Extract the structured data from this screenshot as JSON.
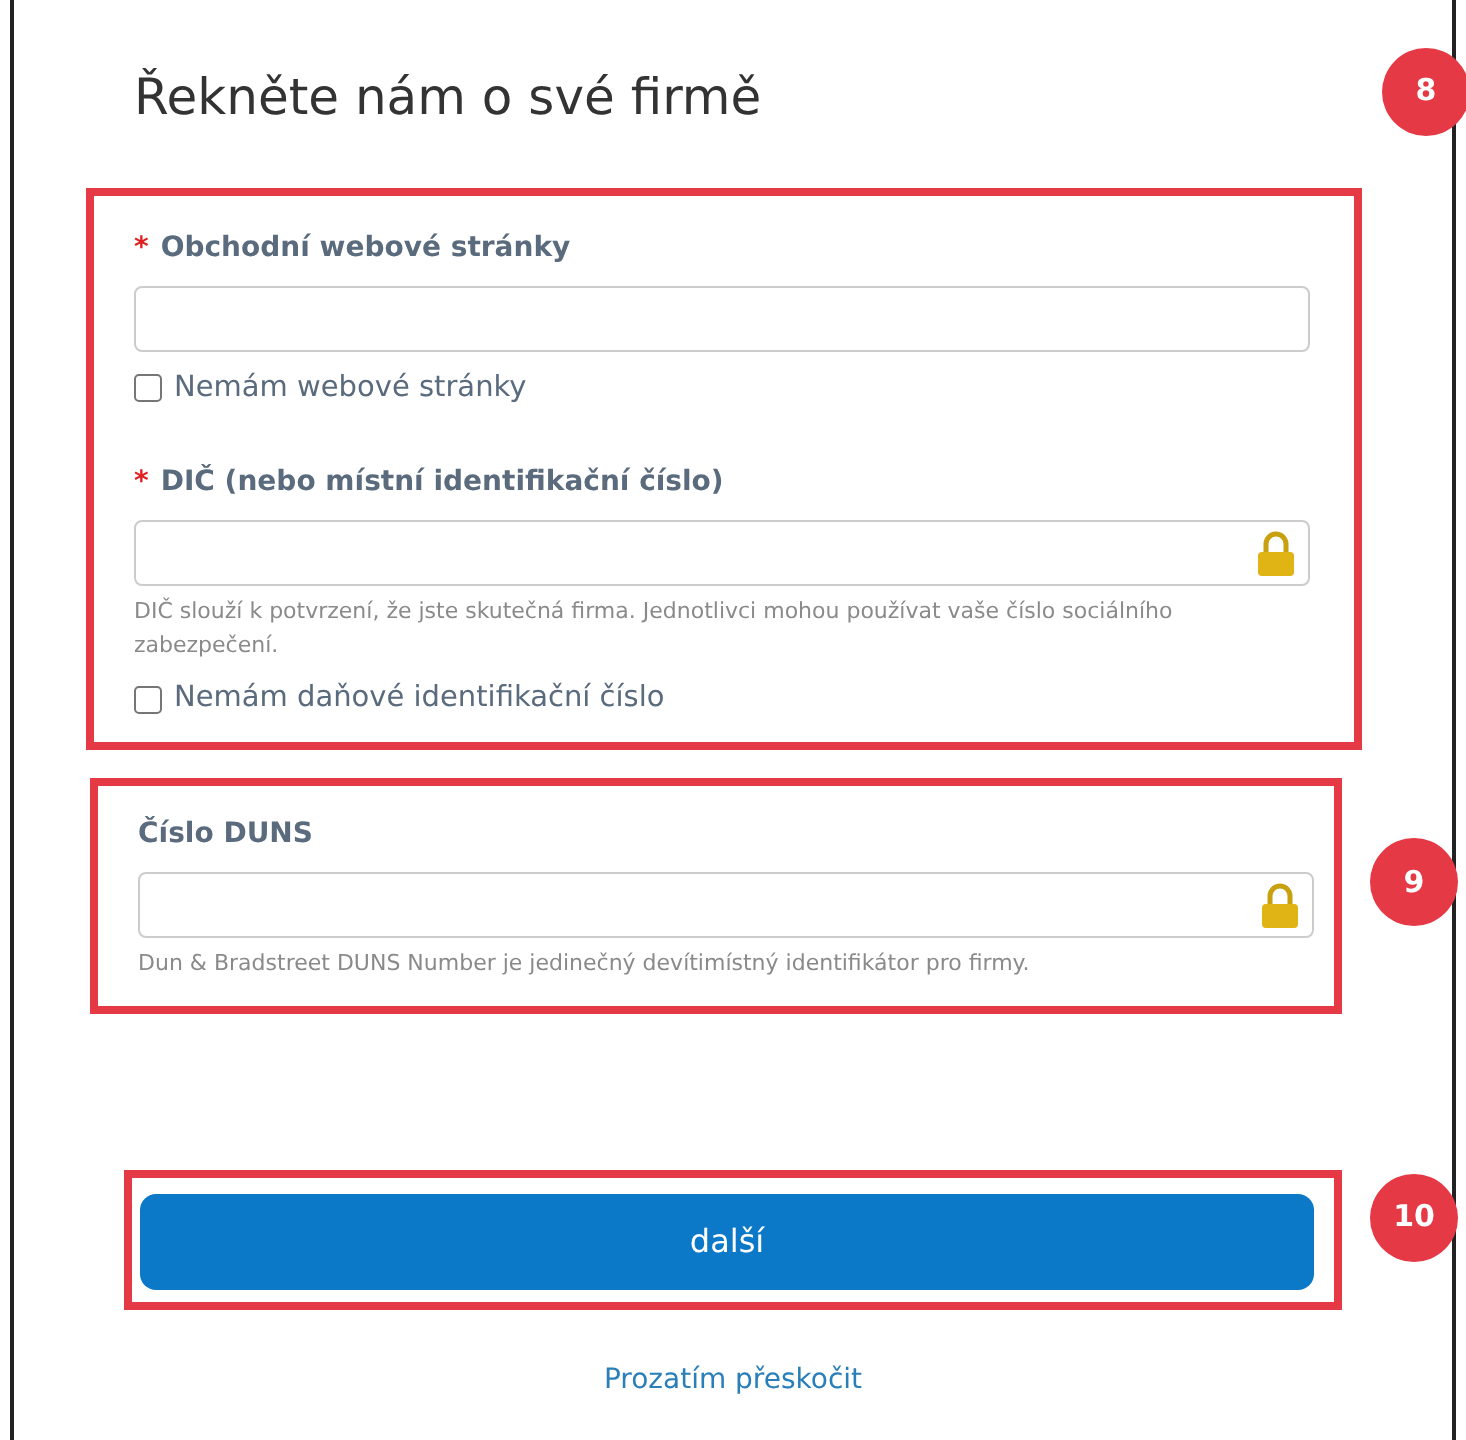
{
  "title": "Řekněte nám o své firmě",
  "sections": [
    {
      "callout": "8",
      "fields": [
        {
          "label": "Obchodní webové stránky",
          "required_marker": "*",
          "kind": "text",
          "checkbox": {
            "label": "Nemám webové stránky",
            "checked": false
          }
        },
        {
          "label": "DIČ (nebo místní identifikační číslo)",
          "required_marker": "*",
          "kind": "locked",
          "help": "DIČ slouží k potvrzení, že jste skutečná firma. Jednotlivci mohou používat vaše číslo sociálního zabezpečení.",
          "checkbox": {
            "label": "Nemám daňové identifikační číslo",
            "checked": false
          }
        }
      ]
    },
    {
      "callout": "9",
      "fields": [
        {
          "label": "Číslo DUNS",
          "kind": "locked",
          "help": "Dun & Bradstreet DUNS Number je jedinečný devítimístný identifikátor pro firmy."
        }
      ]
    }
  ],
  "next_button": {
    "label": "další",
    "callout": "10"
  },
  "skip_link": "Prozatím přeskočit"
}
